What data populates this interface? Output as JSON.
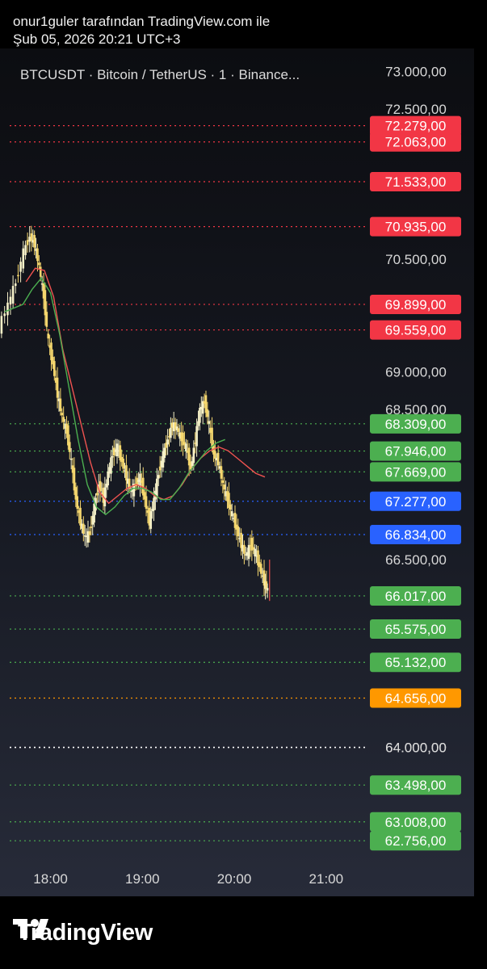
{
  "header": {
    "author_line": "onur1guler tarafından TradingView.com ile",
    "date_line": "Şub 05, 2026 20:21 UTC+3"
  },
  "chart": {
    "symbol_line": "BTCUSDT · Bitcoin / TetherUS · 1 · Binance..."
  },
  "footer": {
    "brand": "TradingView",
    "logo_icon": "tradingview-logo-icon"
  },
  "colors": {
    "red_label": "#f23645",
    "green_label": "#4caf50",
    "blue_label": "#2962ff",
    "orange_label": "#ff9800",
    "up_candle": "#f5f0c8",
    "down_candle": "#f5d76e",
    "ma_red": "#ef5350",
    "ma_green": "#4caf50"
  },
  "chart_data": {
    "type": "line",
    "ylim": [
      62500,
      73200
    ],
    "xlim": [
      "17:27",
      "21:27"
    ],
    "x_ticks": [
      "18:00",
      "19:00",
      "20:00",
      "21:00"
    ],
    "y_ticks": [
      "73.000,00",
      "72.500,00",
      "70.500,00",
      "69.000,00",
      "68.500,00",
      "66.500,00",
      "64.000,00"
    ],
    "levels": [
      {
        "label": "72.279,00",
        "value": 72279,
        "color": "red"
      },
      {
        "label": "72.063,00",
        "value": 72063,
        "color": "red"
      },
      {
        "label": "71.533,00",
        "value": 71533,
        "color": "red"
      },
      {
        "label": "70.935,00",
        "value": 70935,
        "color": "red"
      },
      {
        "label": "69.899,00",
        "value": 69899,
        "color": "red"
      },
      {
        "label": "69.559,00",
        "value": 69559,
        "color": "red"
      },
      {
        "label": "68.309,00",
        "value": 68309,
        "color": "green"
      },
      {
        "label": "67.946,00",
        "value": 67946,
        "color": "green"
      },
      {
        "label": "67.669,00",
        "value": 67669,
        "color": "green"
      },
      {
        "label": "67.277,00",
        "value": 67277,
        "color": "blue"
      },
      {
        "label": "66.834,00",
        "value": 66834,
        "color": "blue"
      },
      {
        "label": "66.017,00",
        "value": 66017,
        "color": "green"
      },
      {
        "label": "65.575,00",
        "value": 65575,
        "color": "green"
      },
      {
        "label": "65.132,00",
        "value": 65132,
        "color": "green"
      },
      {
        "label": "64.656,00",
        "value": 64656,
        "color": "orange"
      },
      {
        "label": "64.000,00",
        "value": 64000,
        "color": "white"
      },
      {
        "label": "63.498,00",
        "value": 63498,
        "color": "green"
      },
      {
        "label": "63.008,00",
        "value": 63008,
        "color": "green"
      },
      {
        "label": "62.756,00",
        "value": 62756,
        "color": "green"
      }
    ],
    "price_path": {
      "x": [
        "17:27",
        "17:33",
        "17:38",
        "17:43",
        "17:47",
        "17:50",
        "17:53",
        "17:56",
        "17:59",
        "18:02",
        "18:05",
        "18:08",
        "18:11",
        "18:14",
        "18:17",
        "18:20",
        "18:23",
        "18:26",
        "18:29",
        "18:32",
        "18:35",
        "18:38",
        "18:41",
        "18:44",
        "18:47",
        "18:50",
        "18:53",
        "18:56",
        "18:59",
        "19:02",
        "19:05",
        "19:08",
        "19:11",
        "19:14",
        "19:17",
        "19:20",
        "19:23",
        "19:26",
        "19:29",
        "19:32",
        "19:35",
        "19:38",
        "19:41",
        "19:44",
        "19:47",
        "19:50",
        "19:53",
        "19:56",
        "19:59",
        "20:02",
        "20:05",
        "20:08",
        "20:11",
        "20:14",
        "20:17",
        "20:20",
        "20:22"
      ],
      "y": [
        69600,
        69900,
        70200,
        70600,
        70800,
        70700,
        70400,
        70000,
        69400,
        69100,
        68700,
        68400,
        68200,
        67800,
        67300,
        67000,
        66800,
        66850,
        67200,
        67500,
        67300,
        67650,
        67900,
        68000,
        67800,
        67600,
        67400,
        67500,
        67600,
        67300,
        67000,
        67300,
        67650,
        67900,
        68100,
        68300,
        68250,
        68100,
        68000,
        67700,
        68100,
        68500,
        68600,
        68300,
        67900,
        67800,
        67500,
        67300,
        67100,
        66900,
        66700,
        66550,
        66700,
        66600,
        66400,
        66200,
        66100
      ]
    },
    "ma_red_path": {
      "x": [
        "17:44",
        "17:50",
        "17:56",
        "18:02",
        "18:08",
        "18:14",
        "18:20",
        "18:26",
        "18:32",
        "18:38",
        "18:44",
        "18:50",
        "18:56",
        "19:02",
        "19:08",
        "19:14",
        "19:20",
        "19:26",
        "19:32",
        "19:38",
        "19:44",
        "19:50",
        "19:56",
        "20:02",
        "20:08",
        "20:14",
        "20:20"
      ],
      "y": [
        70200,
        70380,
        70350,
        70000,
        69300,
        68800,
        68300,
        67800,
        67400,
        67250,
        67350,
        67450,
        67500,
        67450,
        67350,
        67300,
        67350,
        67500,
        67700,
        67850,
        67950,
        68000,
        67950,
        67850,
        67750,
        67650,
        67600
      ]
    },
    "ma_green_path": {
      "x": [
        "17:30",
        "17:36",
        "17:42",
        "17:48",
        "17:54",
        "18:00",
        "18:06",
        "18:12",
        "18:18",
        "18:24",
        "18:30",
        "18:36",
        "18:42",
        "18:48",
        "18:54",
        "19:00",
        "19:06",
        "19:12",
        "19:18",
        "19:24",
        "19:30",
        "19:36",
        "19:42",
        "19:48",
        "19:54"
      ],
      "y": [
        69800,
        69850,
        69900,
        70100,
        70250,
        70050,
        69500,
        68800,
        68100,
        67500,
        67200,
        67100,
        67200,
        67350,
        67450,
        67450,
        67400,
        67300,
        67300,
        67450,
        67650,
        67800,
        67950,
        68050,
        68100
      ]
    }
  }
}
